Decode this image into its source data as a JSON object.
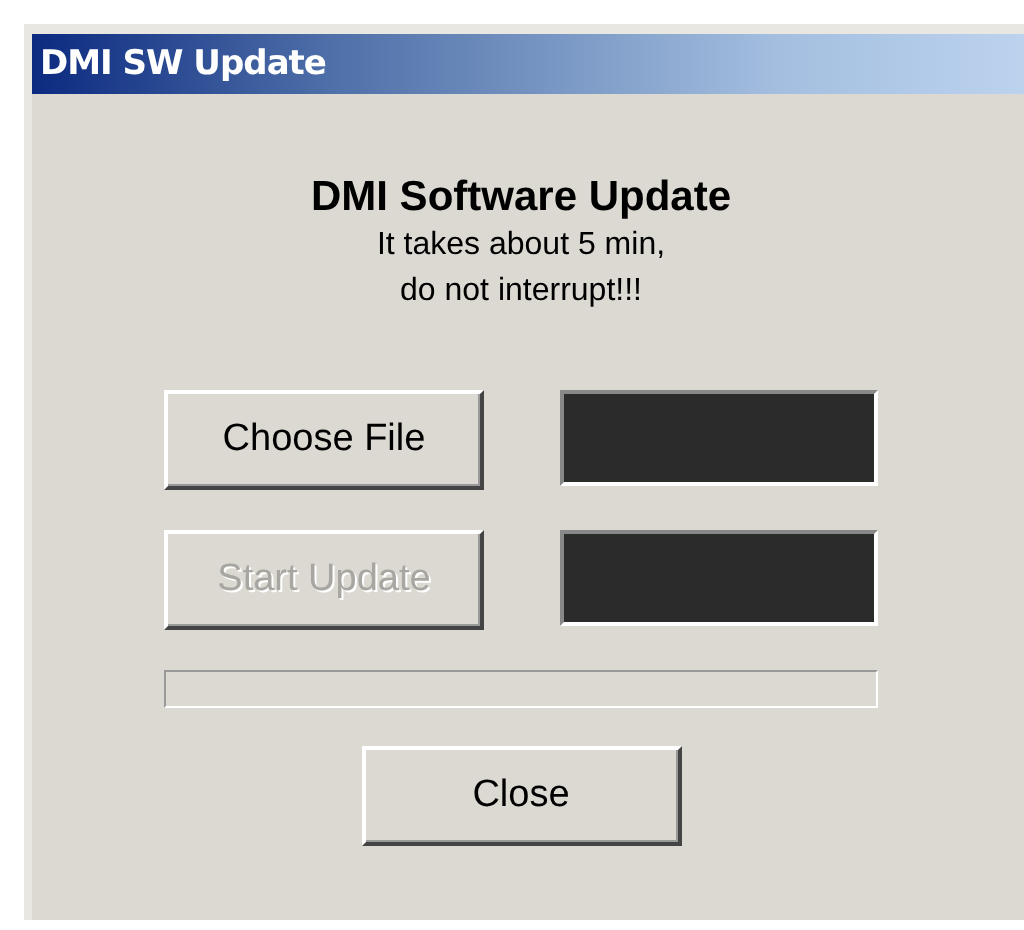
{
  "window": {
    "title": "DMI SW Update"
  },
  "heading": "DMI Software Update",
  "message": [
    "It takes about 5 min,",
    "do not interrupt!!!"
  ],
  "rows": [
    {
      "button": "Choose File",
      "disabled": false
    },
    {
      "button": "Start Update",
      "disabled": true
    }
  ],
  "progress": {
    "level": 0
  },
  "close_button": "Close"
}
